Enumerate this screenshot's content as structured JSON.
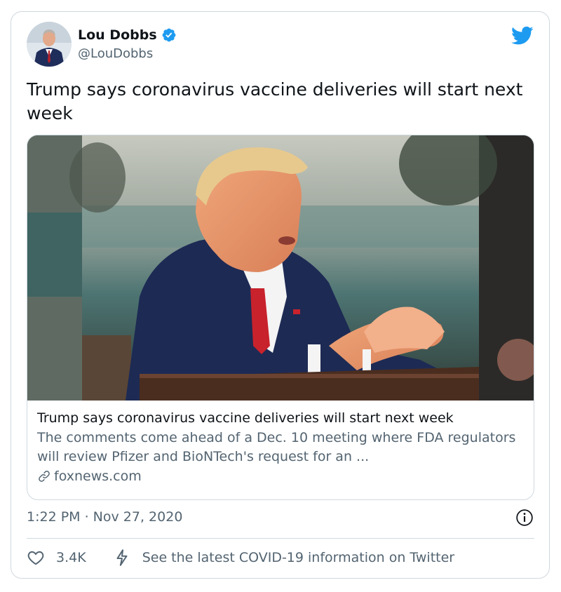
{
  "author": {
    "name": "Lou Dobbs",
    "handle": "@LouDobbs",
    "verified": true
  },
  "tweet": {
    "text": "Trump says coronavirus vaccine deliveries will start next week",
    "timestamp": "1:22 PM · Nov 27, 2020"
  },
  "link_card": {
    "title": "Trump says coronavirus vaccine deliveries will start next week",
    "description": "The comments come ahead of a Dec. 10 meeting where FDA regulators will review Pfizer and BioNTech's request for an ...",
    "domain": "foxnews.com"
  },
  "actions": {
    "likes": "3.4K",
    "covid_info": "See the latest COVID-19 information on Twitter"
  },
  "colors": {
    "twitter_blue": "#1d9bf0",
    "text_primary": "#0f1419",
    "text_secondary": "#536471",
    "border": "#cfd9de"
  },
  "icons": [
    "twitter-bird-icon",
    "verified-badge-icon",
    "link-icon",
    "info-icon",
    "heart-icon",
    "covid-bolt-icon"
  ]
}
